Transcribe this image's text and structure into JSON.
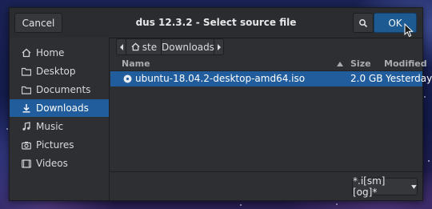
{
  "dialog": {
    "title": "dus 12.3.2 - Select source file",
    "cancel_label": "Cancel",
    "ok_label": "OK",
    "search_icon": "search-icon"
  },
  "sidebar": {
    "items": [
      {
        "label": "Home",
        "icon": "home-icon"
      },
      {
        "label": "Desktop",
        "icon": "folder-icon"
      },
      {
        "label": "Documents",
        "icon": "folder-icon"
      },
      {
        "label": "Downloads",
        "icon": "download-icon",
        "active": true
      },
      {
        "label": "Music",
        "icon": "music-icon"
      },
      {
        "label": "Pictures",
        "icon": "camera-icon"
      },
      {
        "label": "Videos",
        "icon": "video-icon"
      }
    ]
  },
  "pathbar": {
    "home_label": "ste",
    "current_label": "Downloads"
  },
  "filelist": {
    "columns": {
      "name": "Name",
      "size": "Size",
      "modified": "Modified"
    },
    "rows": [
      {
        "name": "ubuntu-18.04.2-desktop-amd64.iso",
        "size": "2.0 GB",
        "modified": "Yesterday",
        "icon": "disc-icon"
      }
    ]
  },
  "filter": {
    "value": "*.i[sm][og]*"
  },
  "colors": {
    "accent": "#215d9c",
    "ok_button": "#1d5a91",
    "dialog_bg": "#2d2f32"
  }
}
